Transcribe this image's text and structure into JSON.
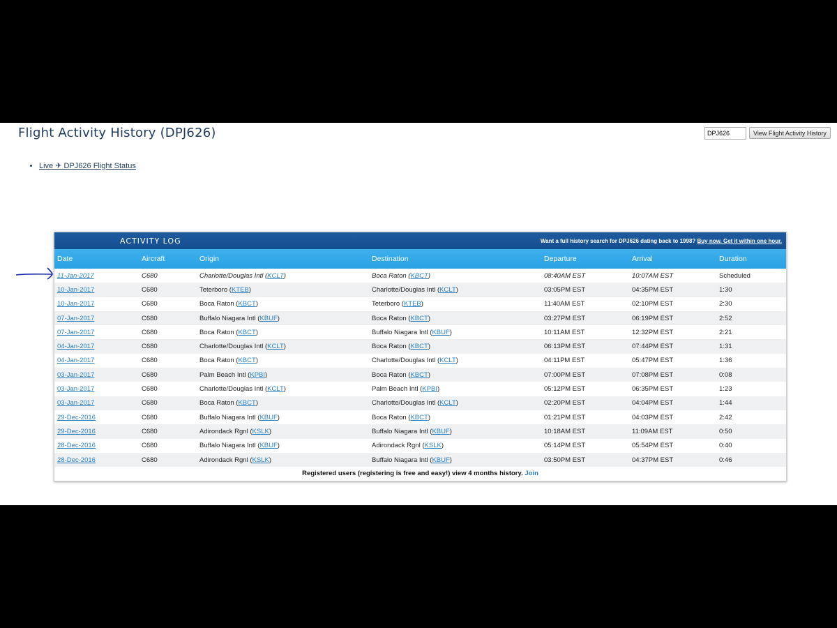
{
  "header": {
    "title": "Flight Activity History (DPJ626)",
    "search_value": "DPJ626",
    "search_button": "View Flight Activity History"
  },
  "links": {
    "live_status": "Live ✈ DPJ626 Flight Status"
  },
  "activity_log": {
    "title": "ACTIVITY LOG",
    "promo_text": "Want a full history search for DPJ626 dating back to 1998? ",
    "promo_link": "Buy now. Get it within one hour.",
    "columns": [
      "Date",
      "Aircraft",
      "Origin",
      "Destination",
      "Departure",
      "Arrival",
      "Duration"
    ],
    "rows": [
      {
        "date": "11-Jan-2017",
        "aircraft": "C680",
        "origin": "Charlotte/Douglas Intl",
        "origin_code": "KCLT",
        "dest": "Boca Raton",
        "dest_code": "KBCT",
        "dep": "08:40AM EST",
        "arr": "10:07AM EST",
        "dur": "Scheduled",
        "future": true
      },
      {
        "date": "10-Jan-2017",
        "aircraft": "C680",
        "origin": "Teterboro",
        "origin_code": "KTEB",
        "dest": "Charlotte/Douglas Intl",
        "dest_code": "KCLT",
        "dep": "03:05PM EST",
        "arr": "04:35PM EST",
        "dur": "1:30"
      },
      {
        "date": "10-Jan-2017",
        "aircraft": "C680",
        "origin": "Boca Raton",
        "origin_code": "KBCT",
        "dest": "Teterboro",
        "dest_code": "KTEB",
        "dep": "11:40AM EST",
        "arr": "02:10PM EST",
        "dur": "2:30"
      },
      {
        "date": "07-Jan-2017",
        "aircraft": "C680",
        "origin": "Buffalo Niagara Intl",
        "origin_code": "KBUF",
        "dest": "Boca Raton",
        "dest_code": "KBCT",
        "dep": "03:27PM EST",
        "arr": "06:19PM EST",
        "dur": "2:52"
      },
      {
        "date": "07-Jan-2017",
        "aircraft": "C680",
        "origin": "Boca Raton",
        "origin_code": "KBCT",
        "dest": "Buffalo Niagara Intl",
        "dest_code": "KBUF",
        "dep": "10:11AM EST",
        "arr": "12:32PM EST",
        "dur": "2:21"
      },
      {
        "date": "04-Jan-2017",
        "aircraft": "C680",
        "origin": "Charlotte/Douglas Intl",
        "origin_code": "KCLT",
        "dest": "Boca Raton",
        "dest_code": "KBCT",
        "dep": "06:13PM EST",
        "arr": "07:44PM EST",
        "dur": "1:31"
      },
      {
        "date": "04-Jan-2017",
        "aircraft": "C680",
        "origin": "Boca Raton",
        "origin_code": "KBCT",
        "dest": "Charlotte/Douglas Intl",
        "dest_code": "KCLT",
        "dep": "04:11PM EST",
        "arr": "05:47PM EST",
        "dur": "1:36"
      },
      {
        "date": "03-Jan-2017",
        "aircraft": "C680",
        "origin": "Palm Beach Intl",
        "origin_code": "KPBI",
        "dest": "Boca Raton",
        "dest_code": "KBCT",
        "dep": "07:00PM EST",
        "arr": "07:08PM EST",
        "dur": "0:08"
      },
      {
        "date": "03-Jan-2017",
        "aircraft": "C680",
        "origin": "Charlotte/Douglas Intl",
        "origin_code": "KCLT",
        "dest": "Palm Beach Intl",
        "dest_code": "KPBI",
        "dep": "05:12PM EST",
        "arr": "06:35PM EST",
        "dur": "1:23"
      },
      {
        "date": "03-Jan-2017",
        "aircraft": "C680",
        "origin": "Boca Raton",
        "origin_code": "KBCT",
        "dest": "Charlotte/Douglas Intl",
        "dest_code": "KCLT",
        "dep": "02:20PM EST",
        "arr": "04:04PM EST",
        "dur": "1:44"
      },
      {
        "date": "29-Dec-2016",
        "aircraft": "C680",
        "origin": "Buffalo Niagara Intl",
        "origin_code": "KBUF",
        "dest": "Boca Raton",
        "dest_code": "KBCT",
        "dep": "01:21PM EST",
        "arr": "04:03PM EST",
        "dur": "2:42"
      },
      {
        "date": "29-Dec-2016",
        "aircraft": "C680",
        "origin": "Adirondack Rgnl",
        "origin_code": "KSLK",
        "dest": "Buffalo Niagara Intl",
        "dest_code": "KBUF",
        "dep": "10:18AM EST",
        "arr": "11:09AM EST",
        "dur": "0:50"
      },
      {
        "date": "28-Dec-2016",
        "aircraft": "C680",
        "origin": "Buffalo Niagara Intl",
        "origin_code": "KBUF",
        "dest": "Adirondack Rgnl",
        "dest_code": "KSLK",
        "dep": "05:14PM EST",
        "arr": "05:54PM EST",
        "dur": "0:40"
      },
      {
        "date": "28-Dec-2016",
        "aircraft": "C680",
        "origin": "Adirondack Rgnl",
        "origin_code": "KSLK",
        "dest": "Buffalo Niagara Intl",
        "dest_code": "KBUF",
        "dep": "03:50PM EST",
        "arr": "04:37PM EST",
        "dur": "0:46"
      }
    ],
    "footer_text": "Registered users (registering is free and easy!) view 4 months history. ",
    "footer_link": "Join"
  },
  "colors": {
    "title_blue": "#1f3a5f",
    "header_bar": "#1f5aa0",
    "column_bar": "#28a1e4",
    "link_blue": "#2a7fc1",
    "annotation_arrow": "#1a2fa8"
  }
}
